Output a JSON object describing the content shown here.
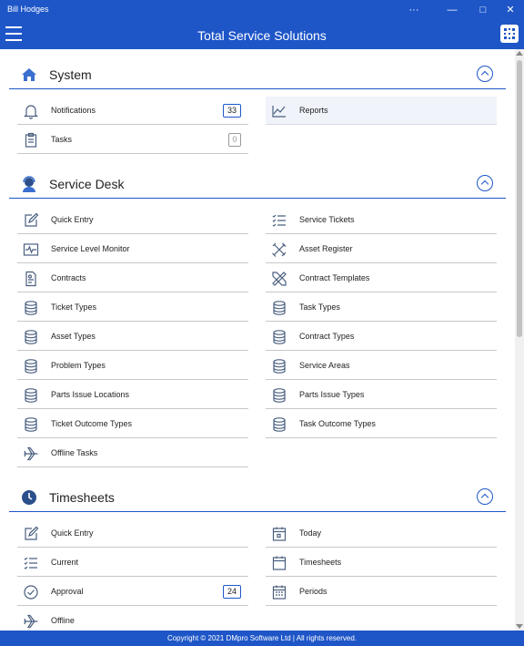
{
  "window": {
    "title": "Bill Hodges",
    "controls": {
      "more": "···",
      "minimize": "—",
      "maximize": "□",
      "close": "✕"
    }
  },
  "app": {
    "title": "Total Service Solutions"
  },
  "colors": {
    "accent": "#1e56c8",
    "icon": "#4a5f80",
    "highlight": "#f0f3fa"
  },
  "sections": {
    "system": {
      "title": "System",
      "icon": "home-icon",
      "items": {
        "notifications": {
          "label": "Notifications",
          "badge": "33",
          "icon": "bell-icon"
        },
        "reports": {
          "label": "Reports",
          "icon": "chart-line-icon"
        },
        "tasks": {
          "label": "Tasks",
          "badge": "0",
          "icon": "clipboard-icon"
        }
      }
    },
    "service_desk": {
      "title": "Service Desk",
      "icon": "agent-icon",
      "items": {
        "quick_entry": {
          "label": "Quick Entry",
          "icon": "edit-icon"
        },
        "service_tickets": {
          "label": "Service Tickets",
          "icon": "checklist-icon"
        },
        "service_level_monitor": {
          "label": "Service Level Monitor",
          "icon": "monitor-icon"
        },
        "asset_register": {
          "label": "Asset Register",
          "icon": "tools-icon"
        },
        "contracts": {
          "label": "Contracts",
          "icon": "document-icon"
        },
        "contract_templates": {
          "label": "Contract Templates",
          "icon": "pencil-ruler-icon"
        },
        "ticket_types": {
          "label": "Ticket Types",
          "icon": "database-icon"
        },
        "task_types": {
          "label": "Task Types",
          "icon": "database-icon"
        },
        "asset_types": {
          "label": "Asset Types",
          "icon": "database-icon"
        },
        "contract_types": {
          "label": "Contract Types",
          "icon": "database-icon"
        },
        "problem_types": {
          "label": "Problem Types",
          "icon": "database-icon"
        },
        "service_areas": {
          "label": "Service Areas",
          "icon": "database-icon"
        },
        "parts_issue_locations": {
          "label": "Parts Issue Locations",
          "icon": "database-icon"
        },
        "parts_issue_types": {
          "label": "Parts Issue Types",
          "icon": "database-icon"
        },
        "ticket_outcome_types": {
          "label": "Ticket Outcome Types",
          "icon": "database-icon"
        },
        "task_outcome_types": {
          "label": "Task Outcome Types",
          "icon": "database-icon"
        },
        "offline_tasks": {
          "label": "Offline Tasks",
          "icon": "airplane-icon"
        }
      }
    },
    "timesheets": {
      "title": "Timesheets",
      "icon": "clock-icon",
      "items": {
        "quick_entry": {
          "label": "Quick Entry",
          "icon": "edit-icon"
        },
        "today": {
          "label": "Today",
          "icon": "calendar-day-icon"
        },
        "current": {
          "label": "Current",
          "icon": "checklist-icon"
        },
        "timesheets": {
          "label": "Timesheets",
          "icon": "calendar-icon"
        },
        "approval": {
          "label": "Approval",
          "badge": "24",
          "icon": "check-circle-icon"
        },
        "periods": {
          "label": "Periods",
          "icon": "calendar-grid-icon"
        },
        "offline": {
          "label": "Offline",
          "icon": "airplane-icon"
        }
      }
    }
  },
  "footer": {
    "text": "Copyright © 2021 DMpro Software Ltd | All rights reserved."
  }
}
